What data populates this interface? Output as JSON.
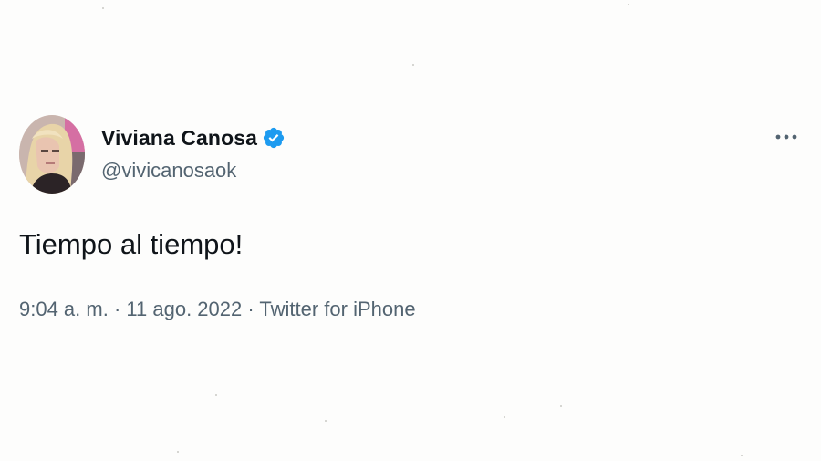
{
  "tweet": {
    "author": {
      "display_name": "Viviana Canosa",
      "handle": "@vivicanosaok",
      "verified": true,
      "avatar_icon": "profile-photo"
    },
    "text": "Tiempo al tiempo!",
    "meta": {
      "time": "9:04 a. m.",
      "separator1": " · ",
      "date": "11 ago. 2022",
      "separator2": " · ",
      "source": "Twitter for iPhone"
    },
    "more_icon": "more-dots-icon"
  },
  "colors": {
    "text_primary": "#0f1419",
    "text_secondary": "#536471",
    "verified_blue": "#1d9bf0",
    "background": "#fdfdfc"
  }
}
